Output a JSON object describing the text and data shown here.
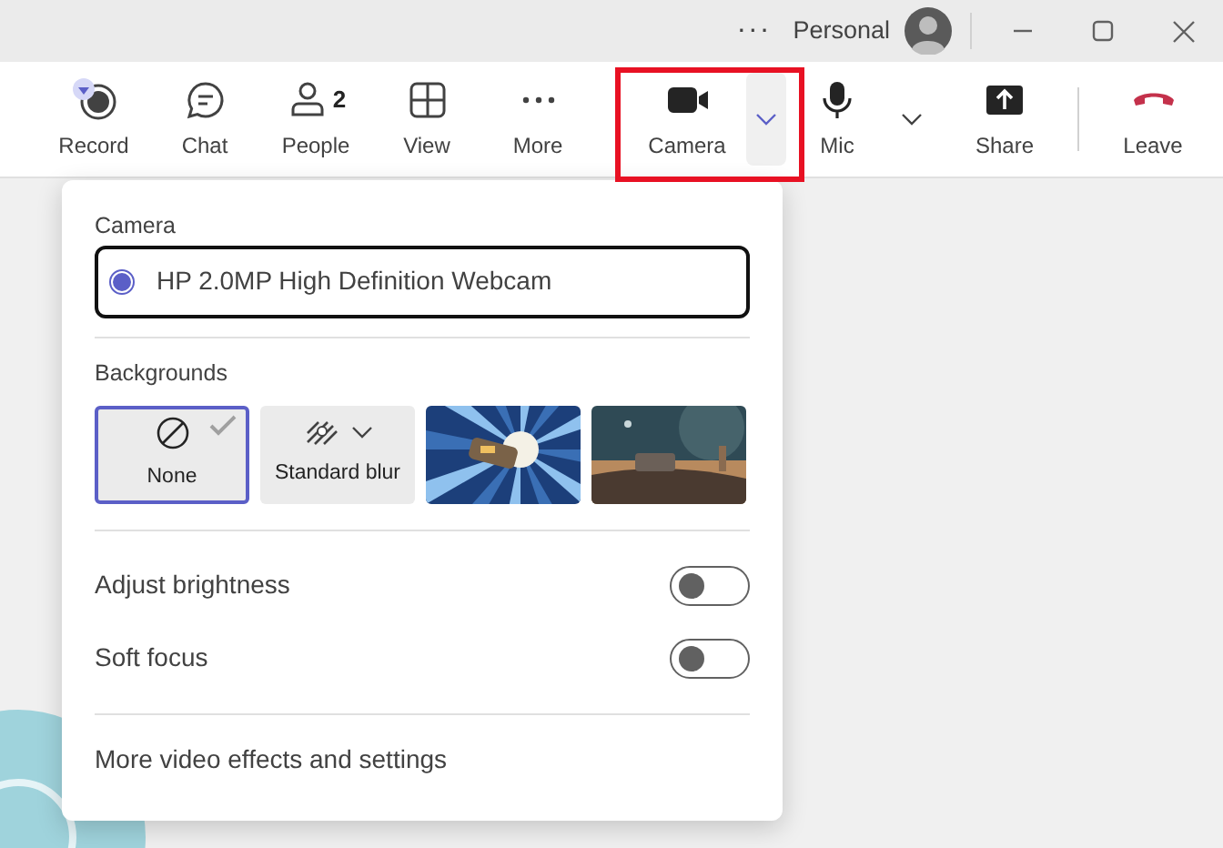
{
  "title_bar": {
    "more": "···",
    "account": "Personal"
  },
  "toolbar": [
    {
      "kind": "record",
      "label": "Record"
    },
    {
      "kind": "chat",
      "label": "Chat"
    },
    {
      "kind": "people",
      "label": "People",
      "count": "2"
    },
    {
      "kind": "view",
      "label": "View"
    },
    {
      "kind": "more",
      "label": "More"
    },
    {
      "kind": "camera",
      "label": "Camera",
      "highlighted": true,
      "expanded": true
    },
    {
      "kind": "mic",
      "label": "Mic",
      "expanded": false
    },
    {
      "kind": "share",
      "label": "Share"
    },
    {
      "kind": "leave",
      "label": "Leave"
    }
  ],
  "camera_menu": {
    "camera_heading": "Camera",
    "devices": [
      {
        "name": "HP 2.0MP High Definition Webcam",
        "selected": true
      }
    ],
    "backgrounds_heading": "Backgrounds",
    "backgrounds": [
      {
        "kind": "none",
        "label": "None",
        "selected": true
      },
      {
        "kind": "blur",
        "label": "Standard blur",
        "selected": false
      },
      {
        "kind": "picture",
        "selected": false
      },
      {
        "kind": "picture",
        "selected": false
      }
    ],
    "toggles": [
      {
        "label": "Adjust brightness",
        "on": false
      },
      {
        "label": "Soft focus",
        "on": false
      }
    ],
    "footer_link": "More video effects and settings"
  }
}
